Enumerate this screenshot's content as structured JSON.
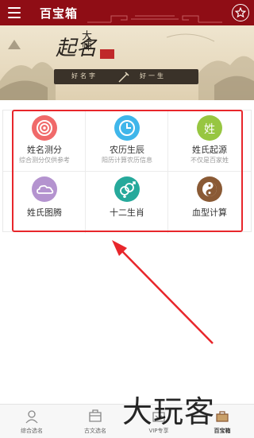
{
  "header": {
    "title": "百宝箱",
    "menu_icon": "hamburger-menu-icon",
    "star_icon": "star-icon"
  },
  "banner": {
    "calligraphy_main": "起名",
    "calligraphy_sub": "大师",
    "plaque_left": "好名字",
    "plaque_right": "好一生"
  },
  "features": [
    {
      "label": "姓名测分",
      "sub": "综合测分仅供参考",
      "icon": "target-icon",
      "color": "#f06a6a"
    },
    {
      "label": "农历生辰",
      "sub": "阳历计算农历信息",
      "icon": "clock-icon",
      "color": "#3fb6ea"
    },
    {
      "label": "姓氏起源",
      "sub": "不仅是百家姓",
      "icon": "surname-icon",
      "icon_text": "姓",
      "color": "#97c641"
    },
    {
      "label": "姓氏图腾",
      "sub": "",
      "icon": "cloud-icon",
      "color": "#b493cf"
    },
    {
      "label": "十二生肖",
      "sub": "",
      "icon": "gender-symbol-icon",
      "color": "#26a99b"
    },
    {
      "label": "血型计算",
      "sub": "",
      "icon": "yin-yang-icon",
      "color": "#8a5a35"
    }
  ],
  "tabs": [
    {
      "label": "综合选名",
      "icon": "user-icon",
      "active": false
    },
    {
      "label": "古文选名",
      "icon": "book-icon",
      "active": false
    },
    {
      "label": "VIP专享",
      "icon": "vip-icon",
      "active": false
    },
    {
      "label": "百宝箱",
      "icon": "toolbox-icon",
      "active": true
    }
  ],
  "watermark": "大玩客",
  "colors": {
    "header": "#8f0d15",
    "highlight": "#e8262b"
  }
}
